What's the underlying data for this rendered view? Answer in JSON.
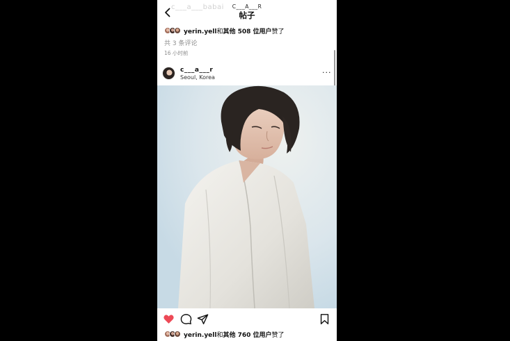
{
  "header": {
    "ghost_text": "c___a___babai",
    "account": "C___A___R",
    "title": "帖子"
  },
  "top_likes": {
    "user": "yerin.yell",
    "middle": "和",
    "others": "其他 508 位用户",
    "suffix": "赞了"
  },
  "comments_link": "共 3 条评论",
  "timestamp": "16 小时前",
  "post": {
    "username": "c___a___r",
    "location": "Seoul, Korea",
    "more": "···"
  },
  "actions": {
    "like_icon": "heart-filled",
    "like_color": "#ed4956",
    "comment_icon": "comment-bubble",
    "share_icon": "paper-plane",
    "save_icon": "bookmark"
  },
  "bottom_likes": {
    "user": "yerin.yell",
    "middle": "和",
    "others": "其他 760 位用户",
    "suffix": "赞了"
  }
}
